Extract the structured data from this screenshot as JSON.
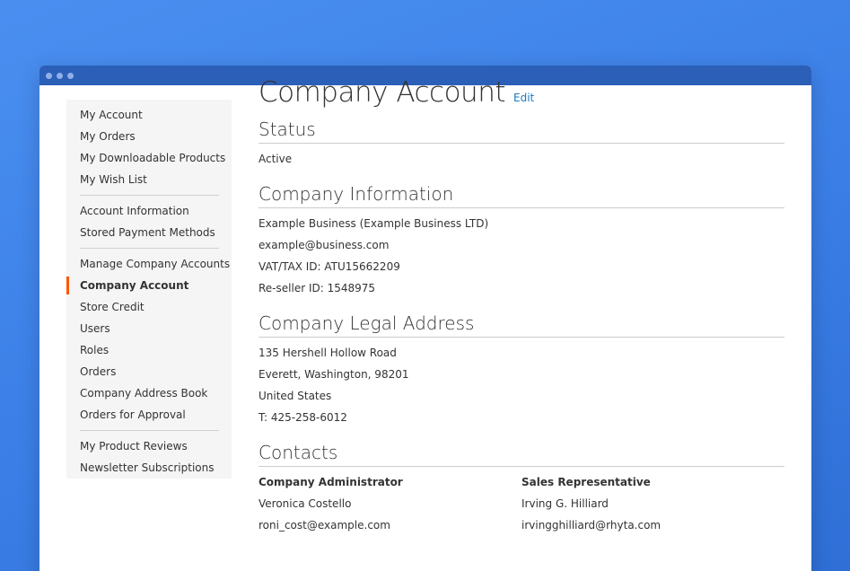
{
  "sidebar": {
    "group1": [
      "My Account",
      "My Orders",
      "My Downloadable Products",
      "My Wish List"
    ],
    "group2": [
      "Account Information",
      "Stored Payment Methods"
    ],
    "group3": [
      "Manage Company Accounts",
      "Company Account",
      "Store Credit",
      "Users",
      "Roles",
      "Orders",
      "Company Address Book",
      "Orders for Approval"
    ],
    "group4": [
      "My Product Reviews",
      "Newsletter Subscriptions"
    ],
    "active": "Company Account"
  },
  "page": {
    "title": "Company Account",
    "edit_label": "Edit"
  },
  "status": {
    "title": "Status",
    "value": "Active"
  },
  "company_info": {
    "title": "Company Information",
    "name": "Example Business (Example Business LTD)",
    "email": "example@business.com",
    "vat": "VAT/TAX ID: ATU15662209",
    "reseller": "Re-seller ID: 1548975"
  },
  "legal_address": {
    "title": "Company Legal Address",
    "street": "135 Hershell Hollow Road",
    "city": "Everett, Washington, 98201",
    "country": "United States",
    "phone": "T: 425-258-6012"
  },
  "contacts": {
    "title": "Contacts",
    "admin": {
      "heading": "Company Administrator",
      "name": "Veronica Costello",
      "email": "roni_cost@example.com"
    },
    "sales": {
      "heading": "Sales Representative",
      "name": "Irving G. Hilliard",
      "email": "irvingghilliard@rhyta.com"
    }
  },
  "colors": {
    "accent": "#ff5501",
    "link": "#1979c3",
    "titlebar": "#2b5fb8"
  }
}
